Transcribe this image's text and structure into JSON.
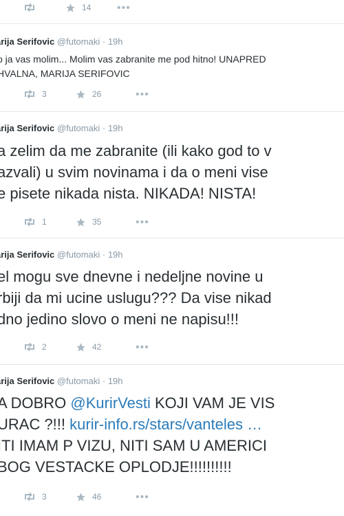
{
  "top_actions": {
    "retweets": "",
    "favorites": "14",
    "more": "•••"
  },
  "tweets": [
    {
      "name": "arija Serifovic",
      "handle": "@futomaki",
      "dot": "·",
      "time": "19h",
      "lines": [
        "o ja vas molim... Molim vas zabranite me pod hitno! UNAPRED",
        "HVALNA, MARIJA SERIFOVIC"
      ],
      "retweets": "3",
      "favorites": "26",
      "more": "•••"
    },
    {
      "name": "arija Serifovic",
      "handle": "@futomaki",
      "dot": "·",
      "time": "19h",
      "lines": [
        "a zelim da me zabranite (ili kako god to v",
        "azvali) u svim novinama i da o meni vise",
        "e pisete nikada nista. NIKADA! NISTA!"
      ],
      "retweets": "1",
      "favorites": "35",
      "more": "•••"
    },
    {
      "name": "arija Serifovic",
      "handle": "@futomaki",
      "dot": "·",
      "time": "19h",
      "lines": [
        "el mogu sve dnevne i nedeljne novine u",
        "rbiji da mi ucine uslugu??? Da vise nikad",
        "dno jedino slovo o meni ne napisu!!!"
      ],
      "retweets": "2",
      "favorites": "42",
      "more": "•••"
    },
    {
      "name": "arija Serifovic",
      "handle": "@futomaki",
      "dot": "·",
      "time": "19h",
      "line1_pre": "A DOBRO ",
      "mention": "@KurirVesti",
      "line1_post": " KOJI VAM JE VIS",
      "line2_pre": "URAC ?!!! ",
      "link": "kurir-info.rs/stars/vanteles",
      "link_ellipsis": " …",
      "lines": [
        "ITI IMAM P VIZU, NITI SAM U AMERICI",
        "BOG VESTACKE OPLODJE!!!!!!!!!!"
      ],
      "retweets": "3",
      "favorites": "46",
      "more": "•••"
    }
  ],
  "colors": {
    "text": "#292f33",
    "muted": "#8899a6",
    "link": "#2b7bb9",
    "divider": "#e1e8ed",
    "icon": "#aab8c2"
  }
}
